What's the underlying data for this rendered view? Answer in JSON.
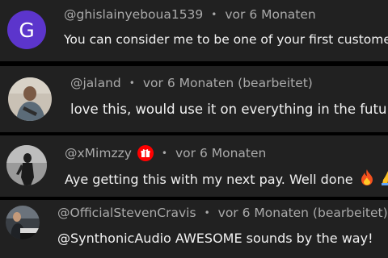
{
  "comments": [
    {
      "author": "@ghislainyeboua1539",
      "time": "vor 6 Monaten",
      "text": "You can consider me to be one of your first customers",
      "avatar_letter": "G",
      "avatar_color": "#5c35cc"
    },
    {
      "author": "@jaland",
      "time": "vor 6 Monaten (bearbeitet)",
      "text": "love this, would use it on everything in the future!"
    },
    {
      "author": "@xMimzzy",
      "time": "vor 6 Monaten",
      "text": "Aye getting this with my next pay. Well done",
      "badge_icon": "gift-badge-icon",
      "emojis": [
        "fire-emoji",
        "folded-hands-emoji"
      ]
    },
    {
      "author": "@OfficialStevenCravis",
      "time": "vor 6 Monaten (bearbeitet)",
      "text": "@SynthonicAudio  AWESOME sounds by the way!"
    }
  ],
  "separator": "•",
  "colors": {
    "page_background": "#000000",
    "card_background": "#212121",
    "meta_text": "#aaaaaa",
    "body_text": "#f1f1f1",
    "badge": "#ff0000"
  }
}
